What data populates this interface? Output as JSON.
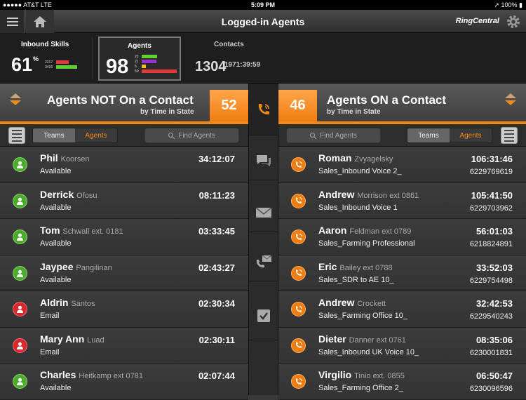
{
  "status_bar": {
    "carrier": "●●●●● AT&T  LTE",
    "time": "5:09 PM",
    "battery": "➚ 100% ▮"
  },
  "header": {
    "title": "Logged-in Agents",
    "logo": "RingCentral"
  },
  "stats": {
    "inbound_skills": {
      "label": "Inbound Skills",
      "value": "61",
      "unit": "%",
      "mini_values": [
        "2217",
        "3416"
      ]
    },
    "agents": {
      "label": "Agents",
      "value": "98",
      "mini_values": [
        "22",
        "21",
        "5",
        "50"
      ]
    },
    "contacts": {
      "label": "Contacts",
      "value": "1304",
      "duration": "1971:39:59"
    }
  },
  "left_panel": {
    "title": "Agents NOT On a Contact",
    "subtitle": "by Time in State",
    "count": "52",
    "tabs": [
      "Teams",
      "Agents"
    ],
    "search_placeholder": "Find Agents",
    "rows": [
      {
        "first": "Phil",
        "last": "Koorsen",
        "state": "Available",
        "time": "34:12:07",
        "icon_color": "green"
      },
      {
        "first": "Derrick",
        "last": "Ofosu",
        "state": "Available",
        "time": "08:11:23",
        "icon_color": "green"
      },
      {
        "first": "Tom",
        "last": "Schwall ext. 0181",
        "state": "Available",
        "time": "03:33:45",
        "icon_color": "green"
      },
      {
        "first": "Jaypee",
        "last": "Pangilinan",
        "state": "Available",
        "time": "02:43:27",
        "icon_color": "green"
      },
      {
        "first": "Aldrin",
        "last": "Santos",
        "state": "Email",
        "time": "02:30:34",
        "icon_color": "red"
      },
      {
        "first": "Mary Ann",
        "last": "Luad",
        "state": "Email",
        "time": "02:30:11",
        "icon_color": "red"
      },
      {
        "first": "Charles",
        "last": "Heitkamp ext 0781",
        "state": "Available",
        "time": "02:07:44",
        "icon_color": "green"
      }
    ]
  },
  "right_panel": {
    "title": "Agents ON a Contact",
    "subtitle": "by Time in State",
    "count": "46",
    "tabs": [
      "Teams",
      "Agents"
    ],
    "search_placeholder": "Find Agents",
    "rows": [
      {
        "first": "Roman",
        "last": "Zvyagelsky",
        "skill": "Sales_Inbound Voice 2_",
        "time": "106:31:46",
        "phone": "6229769619"
      },
      {
        "first": "Andrew",
        "last": "Morrison ext 0861",
        "skill": "Sales_Inbound Voice 1",
        "time": "105:41:50",
        "phone": "6229703962"
      },
      {
        "first": "Aaron",
        "last": "Feldman ext 0789",
        "skill": "Sales_Farming Professional",
        "time": "56:01:03",
        "phone": "6218824891"
      },
      {
        "first": "Eric",
        "last": "Bailey ext 0788",
        "skill": "Sales_SDR to AE 10_",
        "time": "33:52:03",
        "phone": "6229754498"
      },
      {
        "first": "Andrew",
        "last": "Crockett",
        "skill": "Sales_Farming Office 10_",
        "time": "32:42:53",
        "phone": "6229540243"
      },
      {
        "first": "Dieter",
        "last": "Danner ext 0761",
        "skill": "Sales_Inbound UK Voice 10_",
        "time": "08:35:06",
        "phone": "6230001831"
      },
      {
        "first": "Virgilio",
        "last": "Tinio ext. 0855",
        "skill": "Sales_Farming Office 2_",
        "time": "06:50:47",
        "phone": "6230096596"
      }
    ]
  },
  "middle_icons": [
    "phone-icon",
    "chat-icon",
    "mail-icon",
    "phone-mail-icon",
    "checkbox-icon"
  ],
  "colors": {
    "accent": "#f28a1a",
    "available": "#4cab2f",
    "email": "#d9272c"
  }
}
